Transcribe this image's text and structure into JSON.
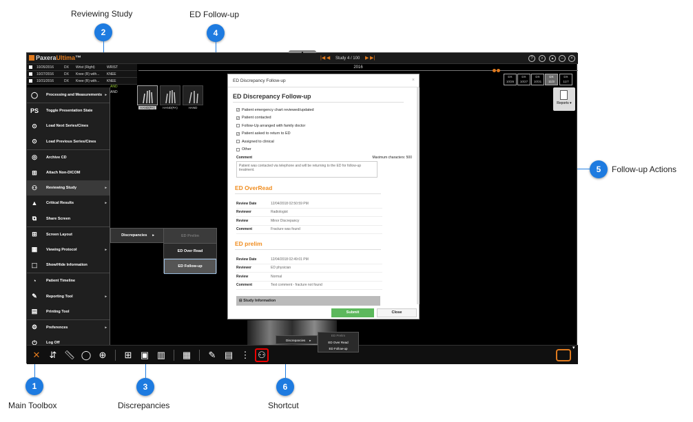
{
  "callouts": [
    {
      "num": "1",
      "label": "Main Toolbox"
    },
    {
      "num": "2",
      "label": "Reviewing Study"
    },
    {
      "num": "3",
      "label": "Discrepancies"
    },
    {
      "num": "4",
      "label": "ED Follow-up"
    },
    {
      "num": "5",
      "label": "Follow-up Actions"
    },
    {
      "num": "6",
      "label": "Shortcut"
    }
  ],
  "app": {
    "brand_a": "Paxera",
    "brand_b": "Ultima",
    "brand_tm": "™",
    "study_counter": "Study 4 / 100",
    "year": "2016",
    "accent": "#e07a1e",
    "study_rows": [
      {
        "date": "10/26/2016",
        "mod": "DX",
        "desc": "Wrist (Right)",
        "body": "WRIST"
      },
      {
        "date": "10/27/2016",
        "mod": "DX",
        "desc": "Knee (R) with...",
        "body": "KNEE"
      },
      {
        "date": "10/31/2016",
        "mod": "DX",
        "desc": "Knee (R) with...",
        "body": "KNEE"
      }
    ],
    "peek_1": "AND",
    "peek_2": "AND",
    "timeline": [
      {
        "mod": "DX",
        "date": "10/26"
      },
      {
        "mod": "DX",
        "date": "10/27"
      },
      {
        "mod": "DX",
        "date": "10/31"
      },
      {
        "mod": "DX",
        "date": "11/3"
      },
      {
        "mod": "DX",
        "date": "11/7"
      }
    ],
    "thumbs": [
      "HAND(PA)",
      "HAND(PA)",
      "HAND"
    ],
    "reports": "Reports"
  },
  "menu": [
    {
      "label": "Processing and Measurements",
      "icon": "processing-icon",
      "sub": true
    },
    {
      "label": "Toggle Presentation State",
      "icon": "ps-icon",
      "sub": false
    },
    {
      "label": "Load Next Series/Cines",
      "icon": "next-icon",
      "sub": false
    },
    {
      "label": "Load Previous Series/Cines",
      "icon": "previous-icon",
      "sub": false
    },
    {
      "label": "Archive CD",
      "icon": "cd-icon",
      "sub": false
    },
    {
      "label": "Attach Non-DICOM",
      "icon": "attach-icon",
      "sub": false
    },
    {
      "label": "Reviewing Study",
      "icon": "reviewing-icon",
      "sub": true
    },
    {
      "label": "Critical Results",
      "icon": "warning-icon",
      "sub": true
    },
    {
      "label": "Share Screen",
      "icon": "share-icon",
      "sub": false
    },
    {
      "label": "Screen Layout",
      "icon": "layout-icon",
      "sub": false
    },
    {
      "label": "Viewing Protocol",
      "icon": "protocol-icon",
      "sub": true
    },
    {
      "label": "Show/Hide Information",
      "icon": "info-icon",
      "sub": false
    },
    {
      "label": "Patient Timeline",
      "icon": "timeline-icon",
      "sub": false
    },
    {
      "label": "Reporting Tool",
      "icon": "reporting-icon",
      "sub": true
    },
    {
      "label": "Printing Tool",
      "icon": "printing-icon",
      "sub": false
    },
    {
      "label": "Preferences",
      "icon": "gear-icon",
      "sub": true
    },
    {
      "label": "Log Off",
      "icon": "power-icon",
      "sub": false
    }
  ],
  "submenu": {
    "discrepancies": "Discrepancies",
    "ed_prelim": "ED Prelim",
    "ed_overread": "ED Over Read",
    "ed_followup": "ED Follow-up"
  },
  "dialog": {
    "title": "ED Discrepancy Follow-up",
    "heading": "ED Discrepancy Follow-up",
    "checks": [
      {
        "label": "Patient emergency chart reviewed/updated",
        "checked": true
      },
      {
        "label": "Patient contacted",
        "checked": true
      },
      {
        "label": "Follow-Up arranged with family doctor",
        "checked": false
      },
      {
        "label": "Patient asked to return to ED",
        "checked": true
      },
      {
        "label": "Assigned to clinical",
        "checked": false
      },
      {
        "label": "Other",
        "checked": false
      }
    ],
    "comment_label": "Comment",
    "max_chars": "Maximum characters: 500",
    "comment_text": "Patient was contacted via telephone and will be returning to the ED for follow-up treatment.",
    "overread": {
      "heading": "ED OverRead",
      "rows": [
        {
          "k": "Review Date",
          "v": "12/04/2018 02:50:59 PM"
        },
        {
          "k": "Reviewer",
          "v": "Radiologist"
        },
        {
          "k": "Review",
          "v": "Minor Discrepancy"
        },
        {
          "k": "Comment",
          "v": "Fracture was found"
        }
      ]
    },
    "prelim": {
      "heading": "ED prelim",
      "rows": [
        {
          "k": "Review Date",
          "v": "12/04/2018 02:49:01 PM"
        },
        {
          "k": "Reviewer",
          "v": "ED physician"
        },
        {
          "k": "Review",
          "v": "Normal"
        },
        {
          "k": "Comment",
          "v": "Test comment - fracture not found"
        }
      ]
    },
    "study_info": "Study Information",
    "submit": "Submit",
    "close": "Close"
  },
  "shortcut_menu": {
    "discrepancies": "Discrepancies",
    "ed_prelim": "ED Prelim",
    "ed_overread": "ED Over Read",
    "ed_followup": "ED Follow-up"
  }
}
